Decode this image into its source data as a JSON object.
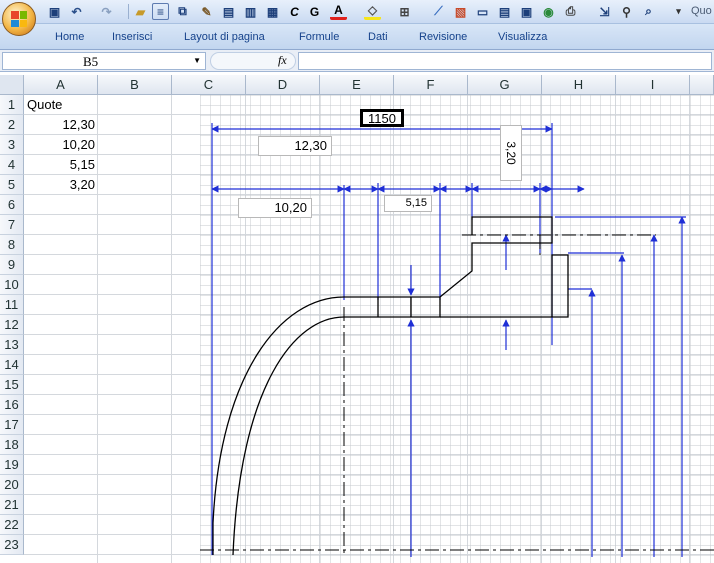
{
  "quick_access": {
    "icons": [
      "save-icon",
      "undo-icon",
      "redo-icon",
      "open-icon",
      "align-icon",
      "copy-icon",
      "format-painter-icon",
      "paste-special-icon",
      "paste-icon",
      "table-icon",
      "italic-c-icon",
      "bold-g-icon",
      "font-color-icon",
      "fill-color-icon",
      "borders-icon",
      "chart-icon",
      "picture-icon",
      "comment-icon",
      "form-icon",
      "image-icon",
      "web-icon",
      "print-icon",
      "export-icon",
      "find-icon",
      "preview-icon"
    ],
    "labels": {
      "italic": "C",
      "bold": "G",
      "font_color": "A"
    },
    "title_fragment": "Quo"
  },
  "ribbon": {
    "tabs": [
      "Home",
      "Inserisci",
      "Layout di pagina",
      "Formule",
      "Dati",
      "Revisione",
      "Visualizza"
    ]
  },
  "formula_bar": {
    "name_box": "B5",
    "fx_label": "fx",
    "formula_value": ""
  },
  "sheet": {
    "columns": [
      "A",
      "B",
      "C",
      "D",
      "E",
      "F",
      "G",
      "H",
      "I"
    ],
    "rows": [
      "1",
      "2",
      "3",
      "4",
      "5",
      "6",
      "7",
      "8",
      "9",
      "10",
      "11",
      "12",
      "13",
      "14",
      "15",
      "16",
      "17",
      "18",
      "19",
      "20",
      "21",
      "22",
      "23"
    ],
    "cells": {
      "A1": "Quote",
      "A2": "12,30",
      "A3": "10,20",
      "A4": "5,15",
      "A5": "3,20"
    }
  },
  "drawing": {
    "dimension_labels": {
      "total": "1150",
      "d1": "12,30",
      "d2": "10,20",
      "d3": "5,15",
      "d4": "3,20"
    },
    "colors": {
      "dimension": "#1f2fd6",
      "outline": "#000000",
      "grid_bg": "#ffffff"
    }
  }
}
